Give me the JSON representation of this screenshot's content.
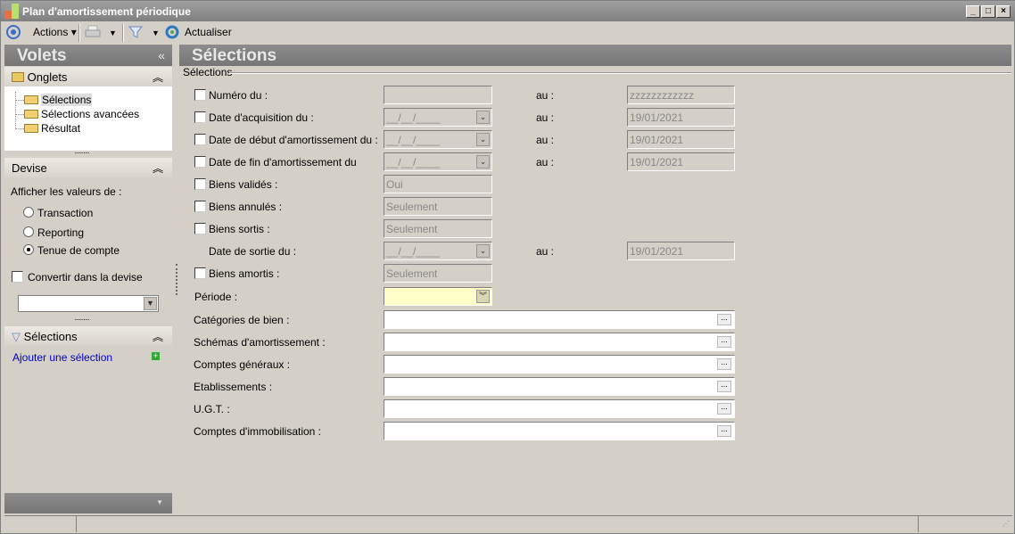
{
  "window": {
    "title": "Plan d'amortissement périodique",
    "controls": [
      "_",
      "□",
      "×"
    ]
  },
  "toolbar": {
    "actions": "Actions",
    "refresh": "Actualiser"
  },
  "sidebar": {
    "title": "Volets",
    "collapse": "«",
    "onglets": {
      "title": "Onglets",
      "items": [
        "Sélections",
        "Sélections avancées",
        "Résultat"
      ]
    },
    "devise": {
      "title": "Devise",
      "prompt": "Afficher les valeurs de :",
      "options": [
        "Transaction",
        "Reporting",
        "Tenue de compte"
      ],
      "selected": 2,
      "convert_label": "Convertir dans la devise",
      "currency": ""
    },
    "selections": {
      "title": "Sélections",
      "add": "Ajouter une sélection"
    }
  },
  "main": {
    "title": "Sélections",
    "group": "Sélections",
    "rows": [
      {
        "label": "Numéro du :",
        "from": "",
        "to_label": "au :",
        "to": "zzzzzzzzzzzz",
        "type": "text"
      },
      {
        "label": "Date d'acquisition du :",
        "from": "__/__/____",
        "to_label": "au :",
        "to": "19/01/2021",
        "type": "date"
      },
      {
        "label": "Date de début d'amortissement du :",
        "from": "__/__/____",
        "to_label": "au :",
        "to": "19/01/2021",
        "type": "date"
      },
      {
        "label": "Date de fin d'amortissement du",
        "from": "__/__/____",
        "to_label": "au :",
        "to": "19/01/2021",
        "type": "date"
      },
      {
        "label": "Biens validés :",
        "from": "Oui"
      },
      {
        "label": "Biens annulés :",
        "from": "Seulement"
      },
      {
        "label": "Biens sortis :",
        "from": "Seulement"
      },
      {
        "label": "Date de sortie du :",
        "from": "__/__/____",
        "to_label": "au :",
        "to": "19/01/2021",
        "type": "date",
        "nocheck": true
      },
      {
        "label": "Biens amortis :",
        "from": "Seulement"
      }
    ],
    "periode": {
      "label": "Période :",
      "value": ""
    },
    "lookups": [
      "Catégories de bien :",
      "Schémas d'amortissement :",
      "Comptes généraux :",
      "Etablissements :",
      "U.G.T. :",
      "Comptes d'immobilisation :"
    ]
  }
}
